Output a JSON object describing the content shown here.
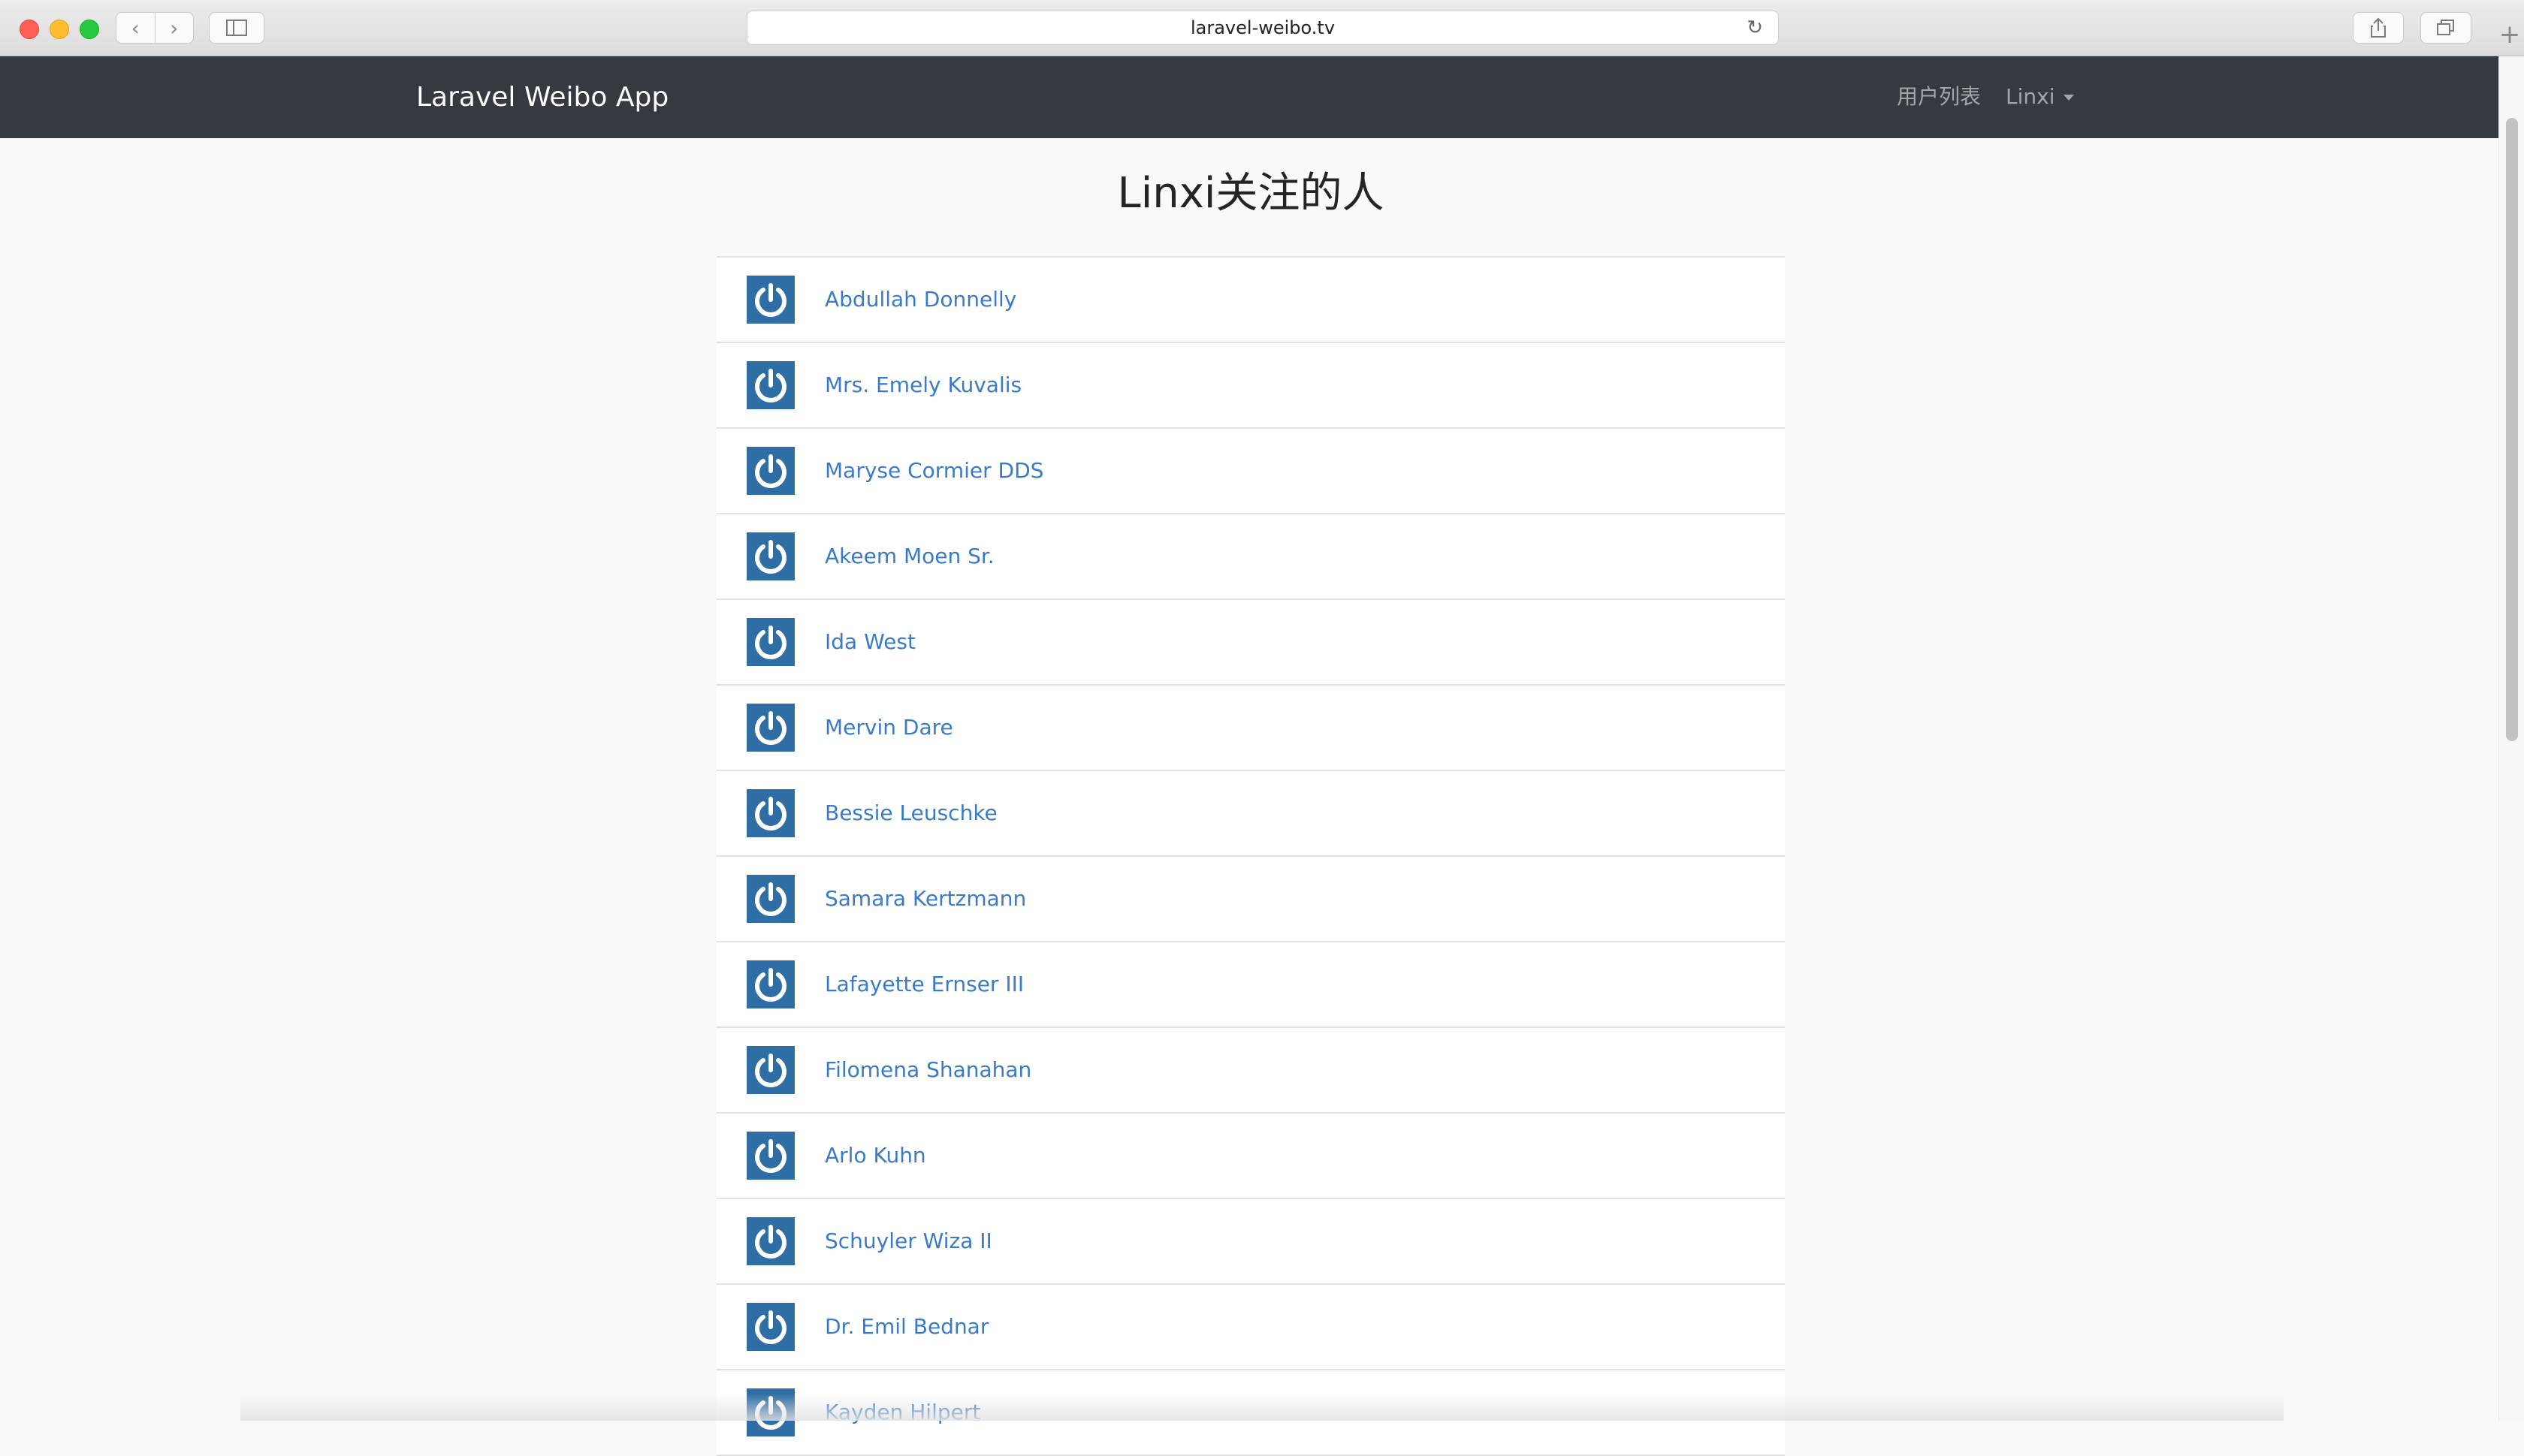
{
  "browser": {
    "url": "laravel-weibo.tv",
    "back_glyph": "‹",
    "forward_glyph": "›",
    "reload_glyph": "↻",
    "new_tab_glyph": "+"
  },
  "navbar": {
    "brand": "Laravel Weibo App",
    "users_link": "用户列表",
    "current_user": "Linxi"
  },
  "page": {
    "title": "Linxi关注的人"
  },
  "followings": [
    {
      "name": "Abdullah Donnelly"
    },
    {
      "name": "Mrs. Emely Kuvalis"
    },
    {
      "name": "Maryse Cormier DDS"
    },
    {
      "name": "Akeem Moen Sr."
    },
    {
      "name": "Ida West"
    },
    {
      "name": "Mervin Dare"
    },
    {
      "name": "Bessie Leuschke"
    },
    {
      "name": "Samara Kertzmann"
    },
    {
      "name": "Lafayette Ernser III"
    },
    {
      "name": "Filomena Shanahan"
    },
    {
      "name": "Arlo Kuhn"
    },
    {
      "name": "Schuyler Wiza II"
    },
    {
      "name": "Dr. Emil Bednar"
    },
    {
      "name": "Kayden Hilpert"
    }
  ],
  "colors": {
    "navbar": "#343a40",
    "avatar": "#2f6ea4",
    "link": "#3a7bc8"
  }
}
